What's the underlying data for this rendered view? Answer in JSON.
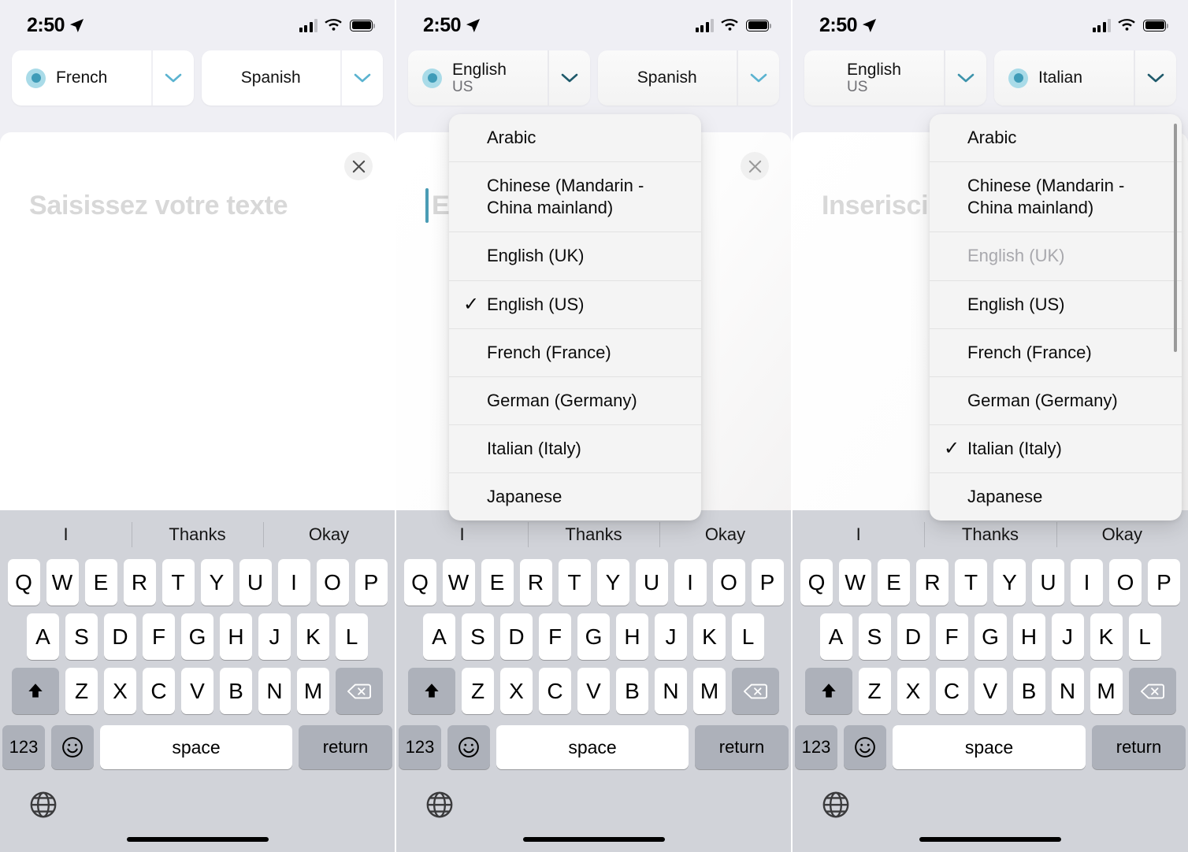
{
  "statusbar": {
    "time": "2:50",
    "location_icon": "location-arrow-icon",
    "cellular_icon": "cellular-bars-icon",
    "wifi_icon": "wifi-icon",
    "battery_icon": "battery-full-icon"
  },
  "panels": [
    {
      "id": "panel-french-spanish",
      "source": {
        "name": "French",
        "sub": "",
        "selected": true
      },
      "target": {
        "name": "Spanish",
        "sub": "",
        "selected": false
      },
      "placeholder": "Saisissez votre texte",
      "caret": false,
      "clear_button": true,
      "dropdown": null
    },
    {
      "id": "panel-english-spanish-dropdown",
      "source": {
        "name": "English",
        "sub": "US",
        "selected": true
      },
      "target": {
        "name": "Spanish",
        "sub": "",
        "selected": false
      },
      "placeholder": "Enter text",
      "caret": true,
      "clear_button": true,
      "dropdown": {
        "anchor": "source",
        "scrollbar": false,
        "items": [
          {
            "label": "Arabic",
            "checked": false,
            "disabled": false
          },
          {
            "label": "Chinese (Mandarin - China mainland)",
            "checked": false,
            "disabled": false
          },
          {
            "label": "English (UK)",
            "checked": false,
            "disabled": false
          },
          {
            "label": "English (US)",
            "checked": true,
            "disabled": false
          },
          {
            "label": "French (France)",
            "checked": false,
            "disabled": false
          },
          {
            "label": "German (Germany)",
            "checked": false,
            "disabled": false
          },
          {
            "label": "Italian (Italy)",
            "checked": false,
            "disabled": false
          },
          {
            "label": "Japanese",
            "checked": false,
            "disabled": false
          }
        ]
      }
    },
    {
      "id": "panel-english-italian-dropdown",
      "source": {
        "name": "English",
        "sub": "US",
        "selected": false
      },
      "target": {
        "name": "Italian",
        "sub": "",
        "selected": true
      },
      "placeholder": "Inserisci il testo",
      "caret": false,
      "clear_button": false,
      "dropdown": {
        "anchor": "target",
        "scrollbar": true,
        "items": [
          {
            "label": "Arabic",
            "checked": false,
            "disabled": false
          },
          {
            "label": "Chinese (Mandarin - China mainland)",
            "checked": false,
            "disabled": false
          },
          {
            "label": "English (UK)",
            "checked": false,
            "disabled": true
          },
          {
            "label": "English (US)",
            "checked": false,
            "disabled": false
          },
          {
            "label": "French (France)",
            "checked": false,
            "disabled": false
          },
          {
            "label": "German (Germany)",
            "checked": false,
            "disabled": false
          },
          {
            "label": "Italian (Italy)",
            "checked": true,
            "disabled": false
          },
          {
            "label": "Japanese",
            "checked": false,
            "disabled": false
          }
        ]
      }
    }
  ],
  "keyboard": {
    "suggestions": [
      "I",
      "Thanks",
      "Okay"
    ],
    "row1": [
      "Q",
      "W",
      "E",
      "R",
      "T",
      "Y",
      "U",
      "I",
      "O",
      "P"
    ],
    "row2": [
      "A",
      "S",
      "D",
      "F",
      "G",
      "H",
      "J",
      "K",
      "L"
    ],
    "row3": [
      "Z",
      "X",
      "C",
      "V",
      "B",
      "N",
      "M"
    ],
    "shift_icon": "shift-up-arrow-icon",
    "backspace_icon": "backspace-delete-icon",
    "numeric_label": "123",
    "emoji_icon": "emoji-smiley-icon",
    "space_label": "space",
    "return_label": "return",
    "globe_icon": "globe-language-icon"
  },
  "colors": {
    "accent_light": "#5bb3d0",
    "accent_dark": "#1f5a6b",
    "radio_ring": "#a9dbe8",
    "radio_dot": "#3f9cb8",
    "caret": "#4a9cb5",
    "panel_bg": "#efeff4",
    "keyboard_bg": "#d1d3d9",
    "key_bg": "#ffffff",
    "key_func_bg": "#adb1ba",
    "placeholder": "#d8d8d8",
    "dropdown_bg": "#f4f4f4",
    "disabled_text": "#a8a8ad"
  }
}
